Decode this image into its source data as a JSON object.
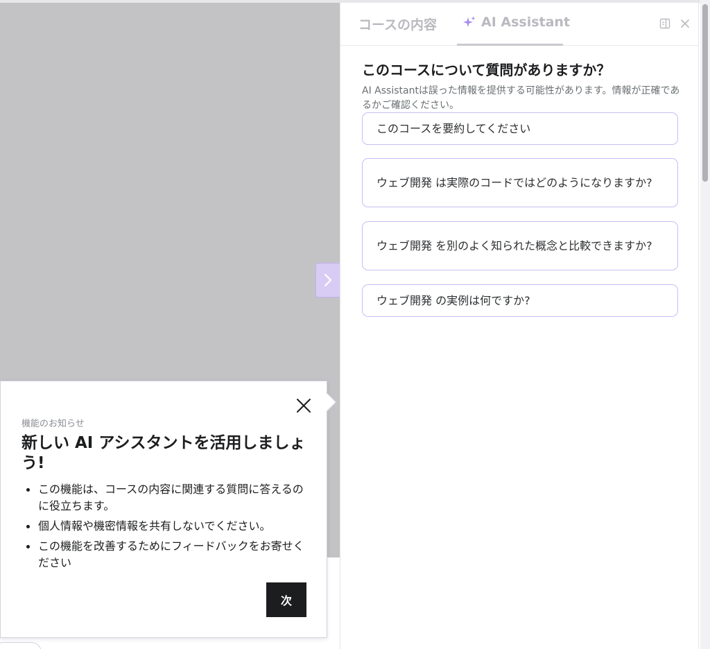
{
  "panel": {
    "tabs": [
      {
        "label": "コースの内容"
      },
      {
        "label": "AI Assistant",
        "icon": "sparkle-icon"
      }
    ],
    "title": "このコースについて質問がありますか？",
    "disclaimer": "AI Assistantは誤った情報を提供する可能性があります。情報が正確であるかご確認ください。",
    "prompts": [
      "このコースを要約してください",
      "ウェブ開発 は実際のコードではどのようになりますか?",
      "ウェブ開発 を別のよく知られた概念と比較できますか?",
      "ウェブ開発 の実例は何ですか?"
    ]
  },
  "popover": {
    "eyebrow": "機能のお知らせ",
    "title": "新しい AI アシスタントを活用しましょう!",
    "bullets": [
      "この機能は、コースの内容に関連する質問に答えるのに役立ちます。",
      "個人情報や機密情報を共有しないでください。",
      "この機能を改善するためにフィードバックをお寄せください"
    ],
    "next_label": "次"
  },
  "colors": {
    "accent": "#a88cf0",
    "prompt_border": "#c6bdf2",
    "expand_button": "#d9ccf4",
    "video_background": "#c3c3c6",
    "dark_button": "#1c1d1f"
  }
}
